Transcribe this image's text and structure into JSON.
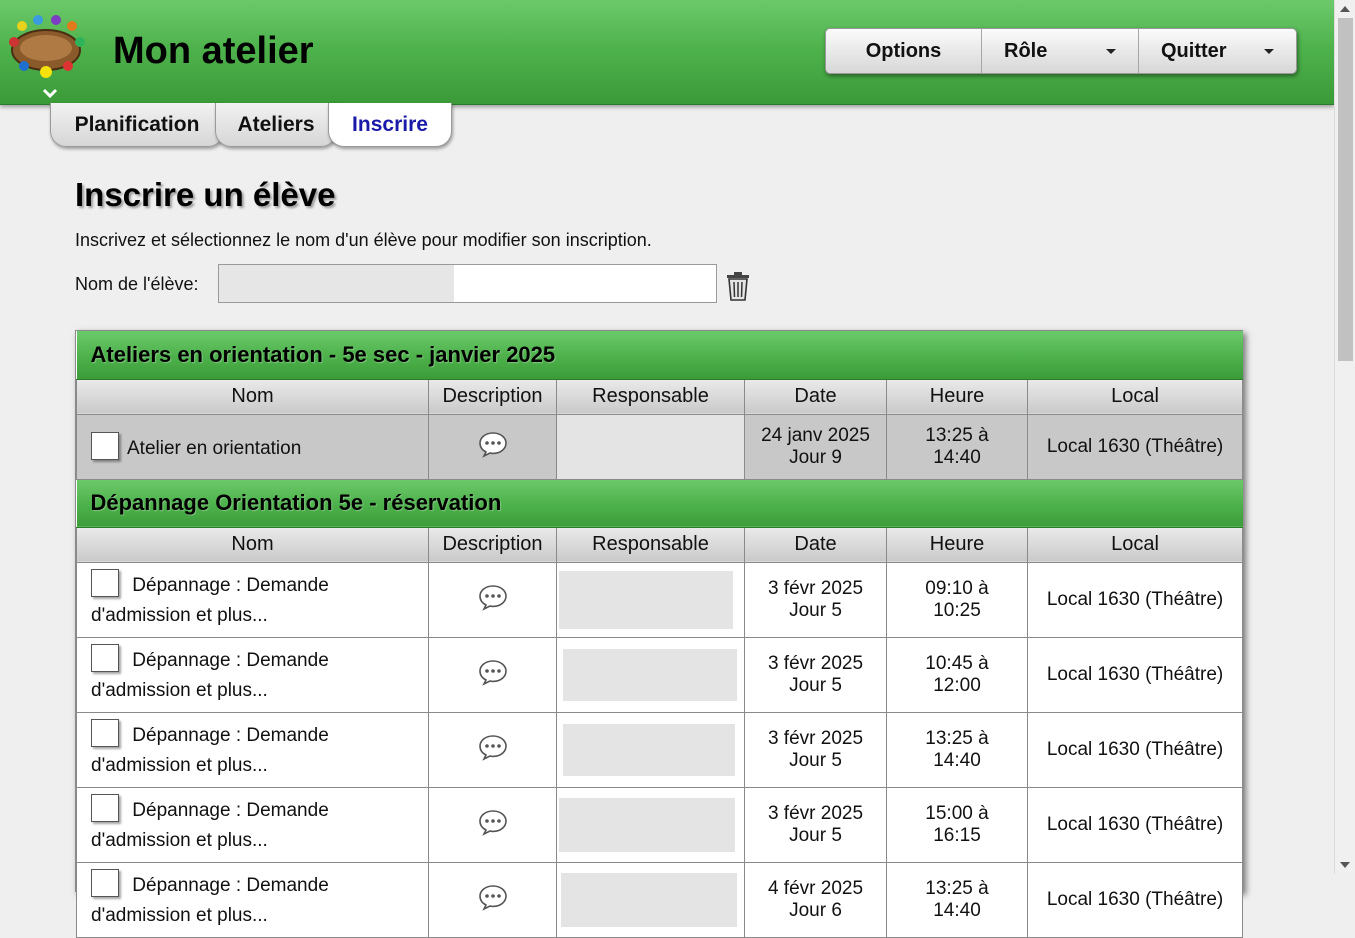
{
  "app": {
    "title": "Mon atelier"
  },
  "menu": {
    "options": "Options",
    "role": "Rôle",
    "quit": "Quitter"
  },
  "tabs": [
    {
      "label": "Planification"
    },
    {
      "label": "Ateliers"
    },
    {
      "label": "Inscrire"
    }
  ],
  "page": {
    "title": "Inscrire un élève",
    "intro": "Inscrivez et sélectionnez le nom d'un élève pour modifier son inscription.",
    "student_label": "Nom de l'élève:",
    "student_value": ""
  },
  "columns": {
    "nom": "Nom",
    "description": "Description",
    "responsable": "Responsable",
    "date": "Date",
    "heure": "Heure",
    "local": "Local"
  },
  "section1": {
    "title": "Ateliers en orientation - 5e sec - janvier 2025",
    "rows": [
      {
        "name": "Atelier en orientation",
        "date1": "24 janv 2025",
        "date2": "Jour 9",
        "time1": "13:25 à",
        "time2": "14:40",
        "local": "Local 1630 (Théâtre)"
      }
    ]
  },
  "section2": {
    "title": "Dépannage Orientation 5e - réservation",
    "rows": [
      {
        "name1": "Dépannage : Demande",
        "name2": "d'admission et plus...",
        "date1": "3 févr 2025",
        "date2": "Jour 5",
        "time1": "09:10 à",
        "time2": "10:25",
        "local": "Local 1630 (Théâtre)"
      },
      {
        "name1": "Dépannage : Demande",
        "name2": "d'admission et plus...",
        "date1": "3 févr 2025",
        "date2": "Jour 5",
        "time1": "10:45 à",
        "time2": "12:00",
        "local": "Local 1630 (Théâtre)"
      },
      {
        "name1": "Dépannage : Demande",
        "name2": "d'admission et plus...",
        "date1": "3 févr 2025",
        "date2": "Jour 5",
        "time1": "13:25 à",
        "time2": "14:40",
        "local": "Local 1630 (Théâtre)"
      },
      {
        "name1": "Dépannage : Demande",
        "name2": "d'admission et plus...",
        "date1": "3 févr 2025",
        "date2": "Jour 5",
        "time1": "15:00 à",
        "time2": "16:15",
        "local": "Local 1630 (Théâtre)"
      },
      {
        "name1": "Dépannage : Demande",
        "name2": "d'admission et plus...",
        "date1": "4 févr 2025",
        "date2": "Jour 6",
        "time1": "13:25 à",
        "time2": "14:40",
        "local": "Local 1630 (Théâtre)"
      }
    ]
  }
}
